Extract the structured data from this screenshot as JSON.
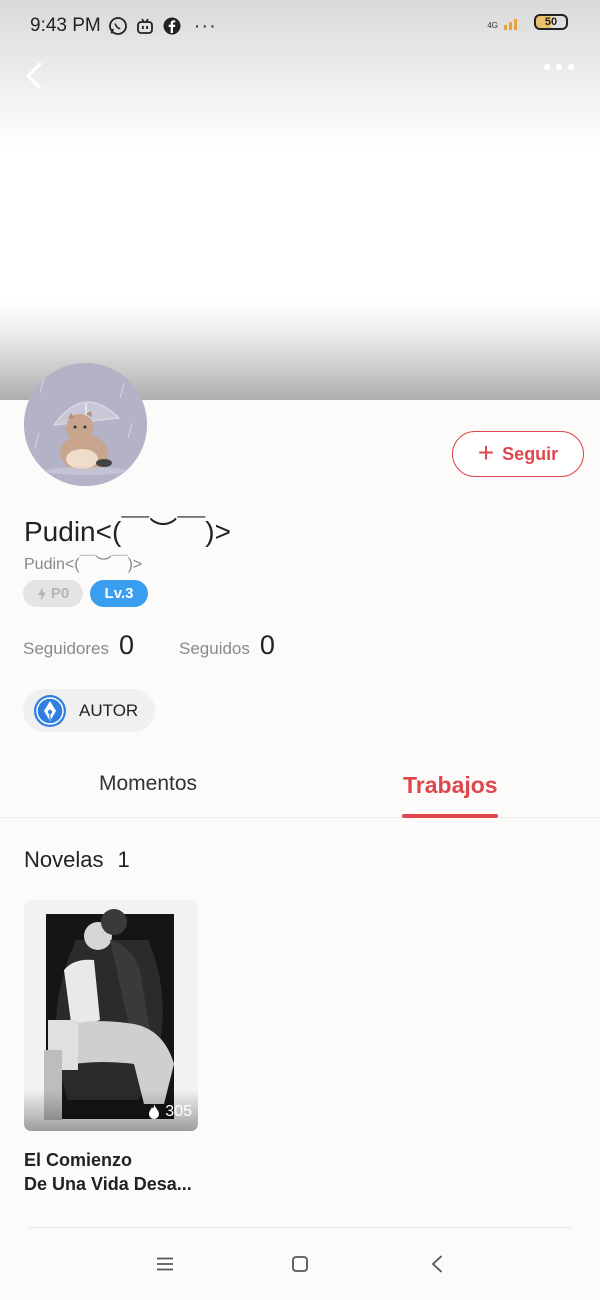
{
  "status_bar": {
    "time": "9:43 PM",
    "overflow": "···",
    "network": "4G",
    "battery": "50",
    "icons": [
      "whatsapp-icon",
      "bilibili-icon",
      "facebook-icon",
      "signal-icon",
      "battery-icon"
    ]
  },
  "header": {
    "back_icon": "back-chevron-icon",
    "more_icon": "more-dots-icon"
  },
  "profile": {
    "username": "Pudin<(￣︶￣)>",
    "handle": "Pudin<(￣︶￣)>",
    "badge_points": "P0",
    "badge_level": "Lv.3",
    "follow_label": "Seguir",
    "followers_label": "Seguidores",
    "followers_count": "0",
    "following_label": "Seguidos",
    "following_count": "0",
    "author_label": "AUTOR"
  },
  "tabs": [
    {
      "label": "Momentos",
      "active": false
    },
    {
      "label": "Trabajos",
      "active": true
    }
  ],
  "works": {
    "section_label": "Novelas",
    "section_count": "1",
    "books": [
      {
        "title_line1": "El Comienzo",
        "title_line2": "De Una Vida Desa...",
        "count": "305"
      }
    ]
  },
  "colors": {
    "accent": "#e0474c",
    "level_badge": "#3a9ef0",
    "background": "#fcfbfa"
  }
}
